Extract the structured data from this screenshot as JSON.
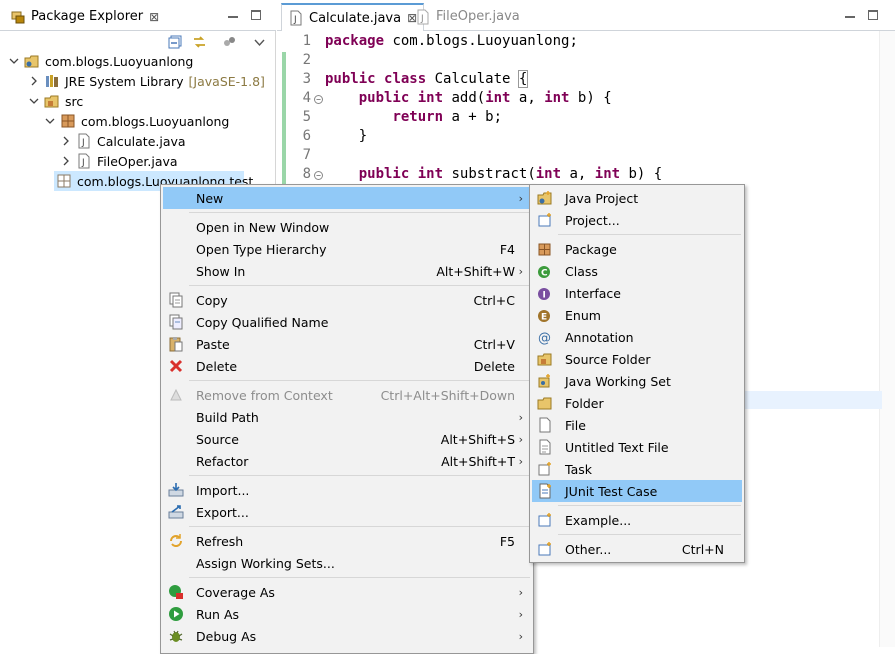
{
  "package_explorer": {
    "tab_label": "Package Explorer",
    "tab_close": "⊠",
    "tree": {
      "project": "com.blogs.Luoyuanlong",
      "jre_label": "JRE System Library",
      "jre_version": "[JavaSE-1.8]",
      "src": "src",
      "package": "com.blogs.Luoyuanlong",
      "file1": "Calculate.java",
      "file2": "FileOper.java",
      "test_package": "com.blogs.Luoyuanlong.test"
    }
  },
  "editor": {
    "active_tab": "Calculate.java",
    "active_tab_close": "⊠",
    "inactive_tab": "FileOper.java",
    "line_numbers": [
      "1",
      "2",
      "3",
      "4",
      "5",
      "6",
      "7",
      "8"
    ],
    "lines": {
      "l1_kw": "package",
      "l1_rest": " com.blogs.Luoyuanlong;",
      "l3_kw1": "public",
      "l3_kw2": "class",
      "l3_name": " Calculate ",
      "l3_brace": "{",
      "l4_kw1": "public",
      "l4_kw2": "int",
      "l4_a": " add(",
      "l4_kw3": "int",
      "l4_b": " a, ",
      "l4_kw4": "int",
      "l4_c": " b) {",
      "l5_kw": "return",
      "l5_rest": " a + b;",
      "l6": "}",
      "l8_kw1": "public",
      "l8_kw2": "int",
      "l8_a": " substract(",
      "l8_kw3": "int",
      "l8_b": " a, ",
      "l8_kw4": "int",
      "l8_c": " b) {"
    }
  },
  "context_menu": {
    "new": "New",
    "open_new_window": "Open in New Window",
    "open_type_hierarchy": "Open Type Hierarchy",
    "open_type_hierarchy_key": "F4",
    "show_in": "Show In",
    "show_in_key": "Alt+Shift+W",
    "copy": "Copy",
    "copy_key": "Ctrl+C",
    "copy_qualified": "Copy Qualified Name",
    "paste": "Paste",
    "paste_key": "Ctrl+V",
    "delete": "Delete",
    "delete_key": "Delete",
    "remove_context": "Remove from Context",
    "remove_context_key": "Ctrl+Alt+Shift+Down",
    "build_path": "Build Path",
    "source": "Source",
    "source_key": "Alt+Shift+S",
    "refactor": "Refactor",
    "refactor_key": "Alt+Shift+T",
    "import": "Import...",
    "export": "Export...",
    "refresh": "Refresh",
    "refresh_key": "F5",
    "assign_working_sets": "Assign Working Sets...",
    "coverage_as": "Coverage As",
    "run_as": "Run As",
    "debug_as": "Debug As",
    "submenu_arrow": "›"
  },
  "new_menu": {
    "java_project": "Java Project",
    "project": "Project...",
    "package": "Package",
    "class": "Class",
    "interface": "Interface",
    "enum": "Enum",
    "annotation": "Annotation",
    "source_folder": "Source Folder",
    "java_working_set": "Java Working Set",
    "folder": "Folder",
    "file": "File",
    "untitled_text_file": "Untitled Text File",
    "task": "Task",
    "junit_test_case": "JUnit Test Case",
    "example": "Example...",
    "other": "Other...",
    "other_key": "Ctrl+N"
  },
  "colors": {
    "menu_highlight": "#91c9f7",
    "keyword": "#7f0055",
    "tree_selection": "#cce8ff"
  }
}
